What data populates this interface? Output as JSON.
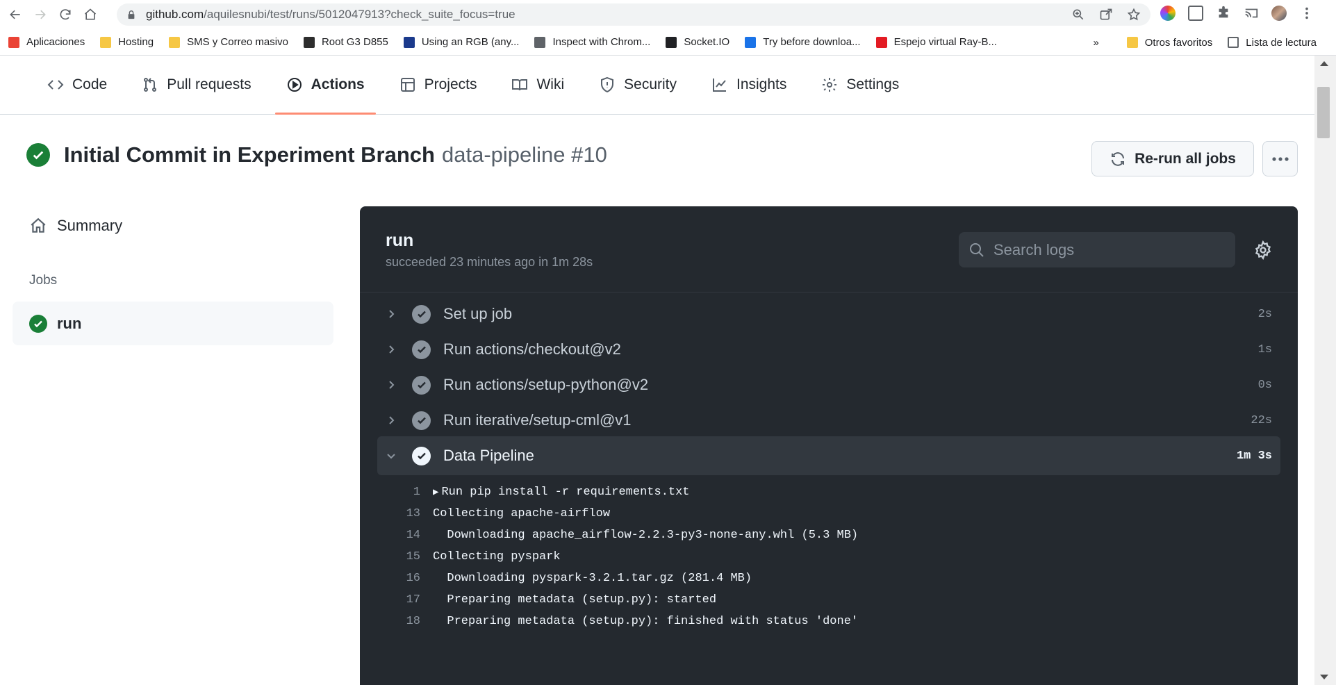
{
  "browser": {
    "url_host": "github.com",
    "url_path": "/aquilesnubi/test/runs/5012047913?check_suite_focus=true",
    "bookmarks": [
      {
        "label": "Aplicaciones",
        "color": "#ea4335"
      },
      {
        "label": "Hosting",
        "color": "#f6c744"
      },
      {
        "label": "SMS y Correo masivo",
        "color": "#f6c744"
      },
      {
        "label": "Root G3 D855",
        "color": "#2d2d2d"
      },
      {
        "label": "Using an RGB (any...",
        "color": "#1b3a8c"
      },
      {
        "label": "Inspect with Chrom...",
        "color": "#5f6368"
      },
      {
        "label": "Socket.IO",
        "color": "#202124"
      },
      {
        "label": "Try before downloa...",
        "color": "#1a73e8"
      },
      {
        "label": "Espejo virtual Ray-B...",
        "color": "#e31b23"
      }
    ],
    "bookmarks_right": [
      {
        "label": "Otros favoritos"
      },
      {
        "label": "Lista de lectura"
      }
    ],
    "overflow": "»"
  },
  "repo_nav": {
    "tabs": [
      {
        "label": "Code",
        "icon": "code-icon"
      },
      {
        "label": "Pull requests",
        "icon": "pull-request-icon"
      },
      {
        "label": "Actions",
        "icon": "play-icon"
      },
      {
        "label": "Projects",
        "icon": "table-icon"
      },
      {
        "label": "Wiki",
        "icon": "book-icon"
      },
      {
        "label": "Security",
        "icon": "shield-icon"
      },
      {
        "label": "Insights",
        "icon": "graph-icon"
      },
      {
        "label": "Settings",
        "icon": "gear-icon"
      }
    ],
    "active": "Actions"
  },
  "run": {
    "title": "Initial Commit in Experiment Branch",
    "workflow": "data-pipeline #10",
    "status": "success",
    "rerun_label": "Re-run all jobs"
  },
  "sidebar": {
    "summary_label": "Summary",
    "jobs_label": "Jobs",
    "jobs": [
      {
        "label": "run",
        "status": "success"
      }
    ]
  },
  "log": {
    "job_name": "run",
    "job_meta": "succeeded 23 minutes ago in 1m 28s",
    "search_placeholder": "Search logs",
    "steps": [
      {
        "name": "Set up job",
        "time": "2s",
        "expanded": false
      },
      {
        "name": "Run actions/checkout@v2",
        "time": "1s",
        "expanded": false
      },
      {
        "name": "Run actions/setup-python@v2",
        "time": "0s",
        "expanded": false
      },
      {
        "name": "Run iterative/setup-cml@v1",
        "time": "22s",
        "expanded": false
      },
      {
        "name": "Data Pipeline",
        "time": "1m 3s",
        "expanded": true
      }
    ],
    "lines": [
      {
        "n": "1",
        "text": "Run pip install -r requirements.txt",
        "collapsible": true
      },
      {
        "n": "13",
        "text": "Collecting apache-airflow"
      },
      {
        "n": "14",
        "text": "  Downloading apache_airflow-2.2.3-py3-none-any.whl (5.3 MB)"
      },
      {
        "n": "15",
        "text": "Collecting pyspark"
      },
      {
        "n": "16",
        "text": "  Downloading pyspark-3.2.1.tar.gz (281.4 MB)"
      },
      {
        "n": "17",
        "text": "  Preparing metadata (setup.py): started"
      },
      {
        "n": "18",
        "text": "  Preparing metadata (setup.py): finished with status 'done'"
      }
    ]
  },
  "colors": {
    "success": "#1a7f37",
    "active_tab_underline": "#fd8c73",
    "log_bg": "#24292f"
  }
}
